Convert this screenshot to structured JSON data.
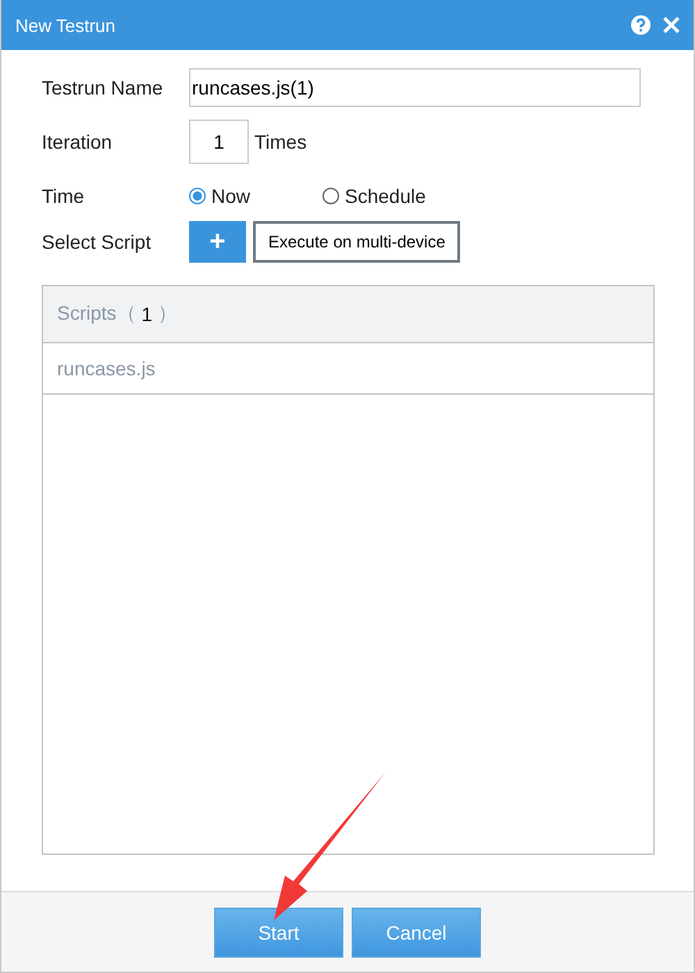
{
  "window": {
    "title": "New Testrun"
  },
  "form": {
    "name_label": "Testrun Name",
    "name_value": "runcases.js(1)",
    "iteration_label": "Iteration",
    "iteration_value": "1",
    "iteration_unit": "Times",
    "time_label": "Time",
    "time_options": [
      {
        "label": "Now",
        "selected": true
      },
      {
        "label": "Schedule",
        "selected": false
      }
    ],
    "script_label": "Select Script",
    "add_button": "+",
    "multi_device_button": "Execute on multi-device"
  },
  "scripts": {
    "heading": "Scripts（ **1** ）",
    "rows": [
      "runcases.js"
    ]
  },
  "buttons": [
    "Start",
    "Cancel"
  ],
  "annotation": {
    "kind": "arrow"
  }
}
